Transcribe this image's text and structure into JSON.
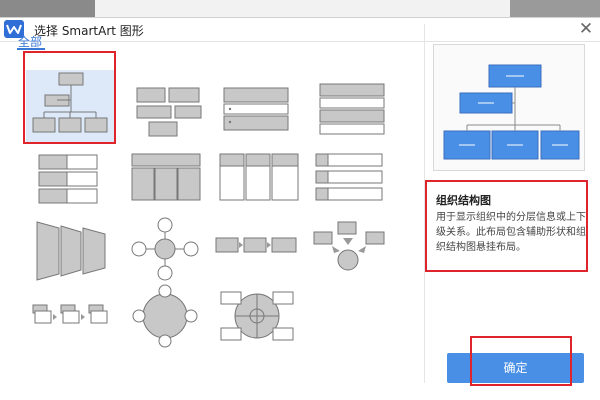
{
  "dialog": {
    "title": "选择 SmartArt 图形",
    "close_glyph": "✕"
  },
  "categories": [
    {
      "label": "全部",
      "active": true
    }
  ],
  "thumbnails": [
    {
      "id": "org-chart",
      "selected": true
    },
    {
      "id": "org-list"
    },
    {
      "id": "stacked-list"
    },
    {
      "id": "vertical-box-list"
    },
    {
      "id": "vertical-bullet-list"
    },
    {
      "id": "table-hierarchy"
    },
    {
      "id": "horizontal-bullet-list"
    },
    {
      "id": "picture-list"
    },
    {
      "id": "step-up-process"
    },
    {
      "id": "radial-cycle"
    },
    {
      "id": "basic-process"
    },
    {
      "id": "converging-arrows"
    },
    {
      "id": "accent-process"
    },
    {
      "id": "radial-venn"
    },
    {
      "id": "segmented-cycle"
    }
  ],
  "detail": {
    "name": "组织结构图",
    "description": "用于显示组织中的分层信息或上下级关系。此布局包含辅助形状和组织结构图悬挂布局。"
  },
  "ok_label": "确定",
  "colors": {
    "accent": "#3a78d6",
    "highlight": "#e0242c",
    "shape_fill": "#c8c8c8",
    "preview_fill": "#4a8fe6"
  }
}
